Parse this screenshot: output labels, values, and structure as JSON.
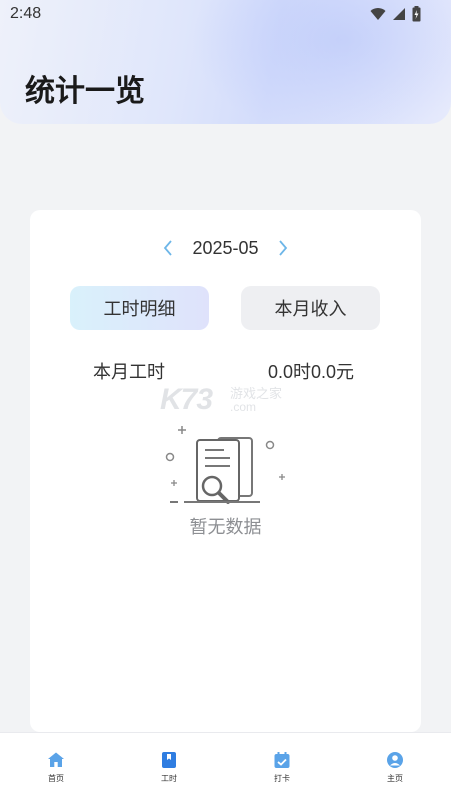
{
  "status_bar": {
    "time": "2:48",
    "icons": [
      "wifi-icon",
      "signal-icon",
      "battery-icon"
    ]
  },
  "header": {
    "title": "统计一览"
  },
  "month_selector": {
    "value": "2025-05",
    "prev_icon": "chevron-left-icon",
    "next_icon": "chevron-right-icon"
  },
  "tabs": [
    {
      "label": "工时明细",
      "active": true
    },
    {
      "label": "本月收入",
      "active": false
    }
  ],
  "summary": {
    "label": "本月工时",
    "value": "0.0时0.0元"
  },
  "watermark": {
    "brand": "K73",
    "cn": "游戏之家",
    "domain": ".com"
  },
  "empty_state": {
    "icon": "empty-document-icon",
    "text": "暂无数据"
  },
  "bottom_nav": [
    {
      "label": "首页",
      "icon": "home-icon"
    },
    {
      "label": "工时",
      "icon": "book-icon"
    },
    {
      "label": "打卡",
      "icon": "calendar-check-icon"
    },
    {
      "label": "主页",
      "icon": "user-icon"
    }
  ],
  "colors": {
    "accent_blue": "#4a90e2",
    "active_nav": "#3b82f6"
  }
}
